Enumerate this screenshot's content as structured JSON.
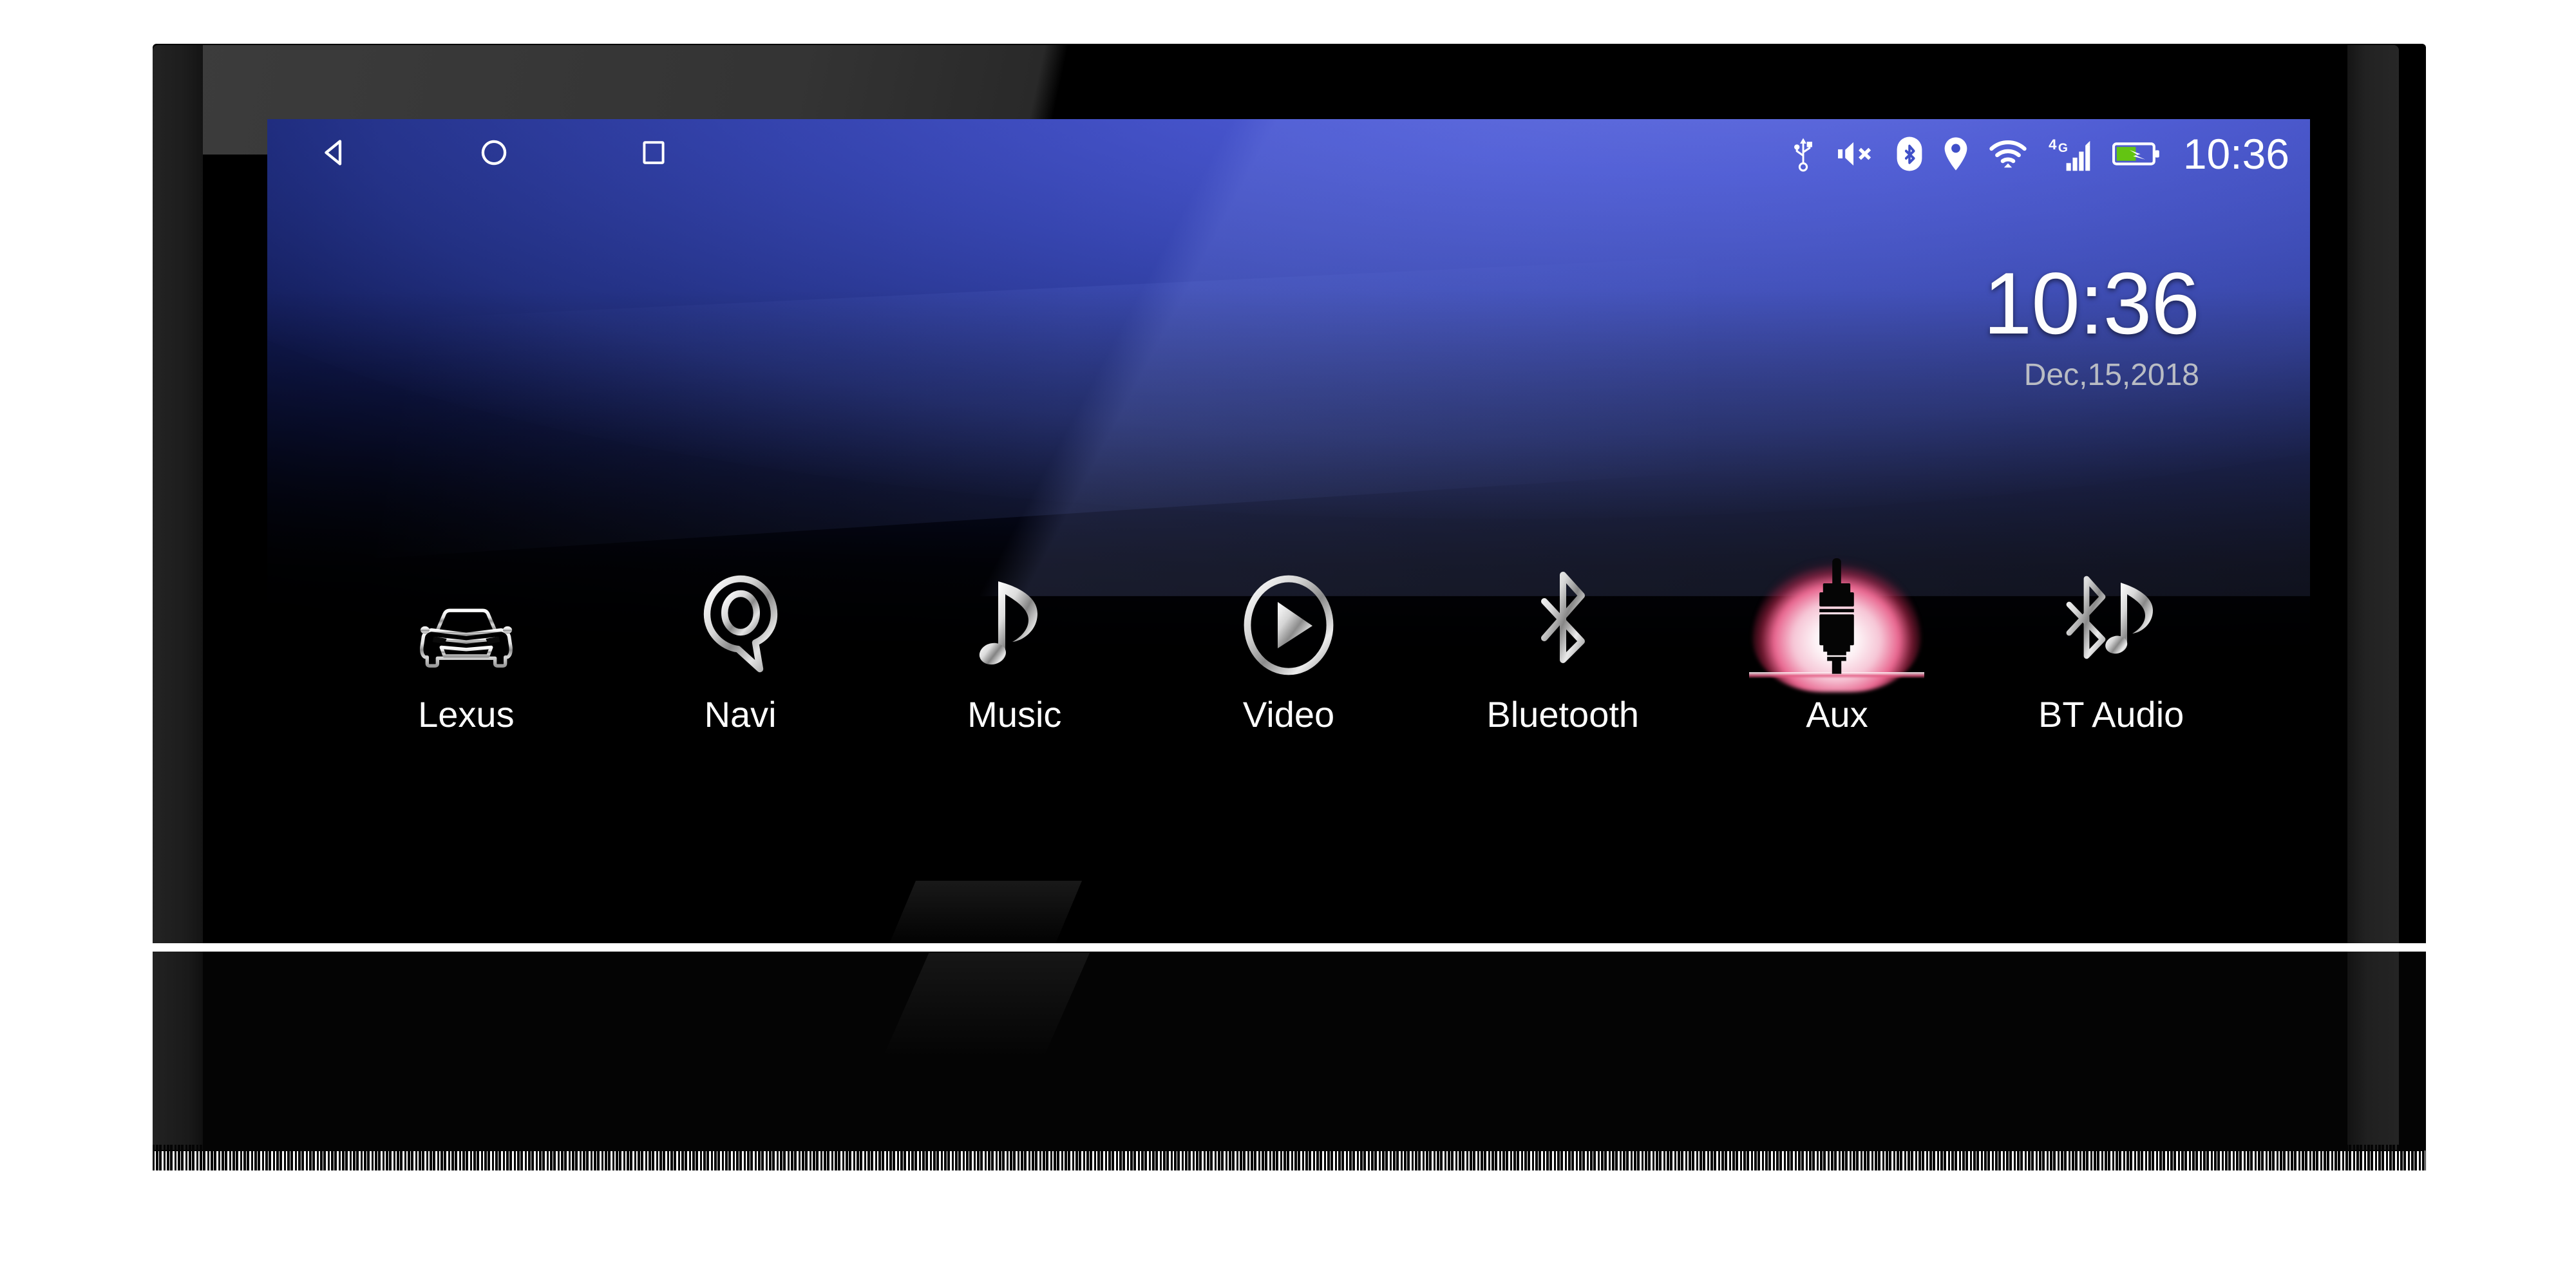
{
  "device": {
    "kind": "car-head-unit",
    "brand_screen": "android-auto-radio"
  },
  "statusbar": {
    "nav": [
      {
        "name": "back",
        "label": "Back",
        "icon": "back-triangle-icon"
      },
      {
        "name": "home",
        "label": "Home",
        "icon": "home-circle-icon"
      },
      {
        "name": "recents",
        "label": "Recent apps",
        "icon": "recents-square-icon"
      }
    ],
    "icons": [
      {
        "name": "usb",
        "label": "USB connected",
        "icon": "usb-icon"
      },
      {
        "name": "mute",
        "label": "Sound muted",
        "icon": "volume-mute-icon"
      },
      {
        "name": "bluetooth",
        "label": "Bluetooth on",
        "icon": "bluetooth-icon"
      },
      {
        "name": "location",
        "label": "Location on",
        "icon": "location-pin-icon"
      },
      {
        "name": "wifi",
        "label": "Wi-Fi connected",
        "icon": "wifi-icon"
      },
      {
        "name": "signal",
        "label": "4G signal",
        "icon": "signal-bars-icon",
        "network": "4G",
        "bars": 4
      },
      {
        "name": "battery",
        "label": "Battery charging",
        "icon": "battery-charging-icon",
        "level_percent": 55,
        "color": "#63c412"
      }
    ],
    "network_label": "4G",
    "time": "10:36"
  },
  "clock_widget": {
    "time": "10:36",
    "date": "Dec,15,2018"
  },
  "apps": [
    {
      "label": "Lexus",
      "icon": "car-front-icon",
      "selected": false
    },
    {
      "label": "Navi",
      "icon": "map-pin-icon",
      "selected": false
    },
    {
      "label": "Music",
      "icon": "music-note-icon",
      "selected": false
    },
    {
      "label": "Video",
      "icon": "play-circle-icon",
      "selected": false
    },
    {
      "label": "Bluetooth",
      "icon": "bluetooth-icon",
      "selected": false
    },
    {
      "label": "Aux",
      "icon": "aux-jack-icon",
      "selected": true
    },
    {
      "label": "BT Audio",
      "icon": "bluetooth-music-icon",
      "selected": false
    }
  ],
  "colors": {
    "wallpaper_blue": "#3b47c4",
    "wallpaper_blue_light": "#5a63d8",
    "screen_black": "#000000",
    "selected_glow_pink": "#e8668f",
    "battery_green": "#63c412",
    "text_white": "#ffffff",
    "date_gray": "#b9bcc4"
  }
}
